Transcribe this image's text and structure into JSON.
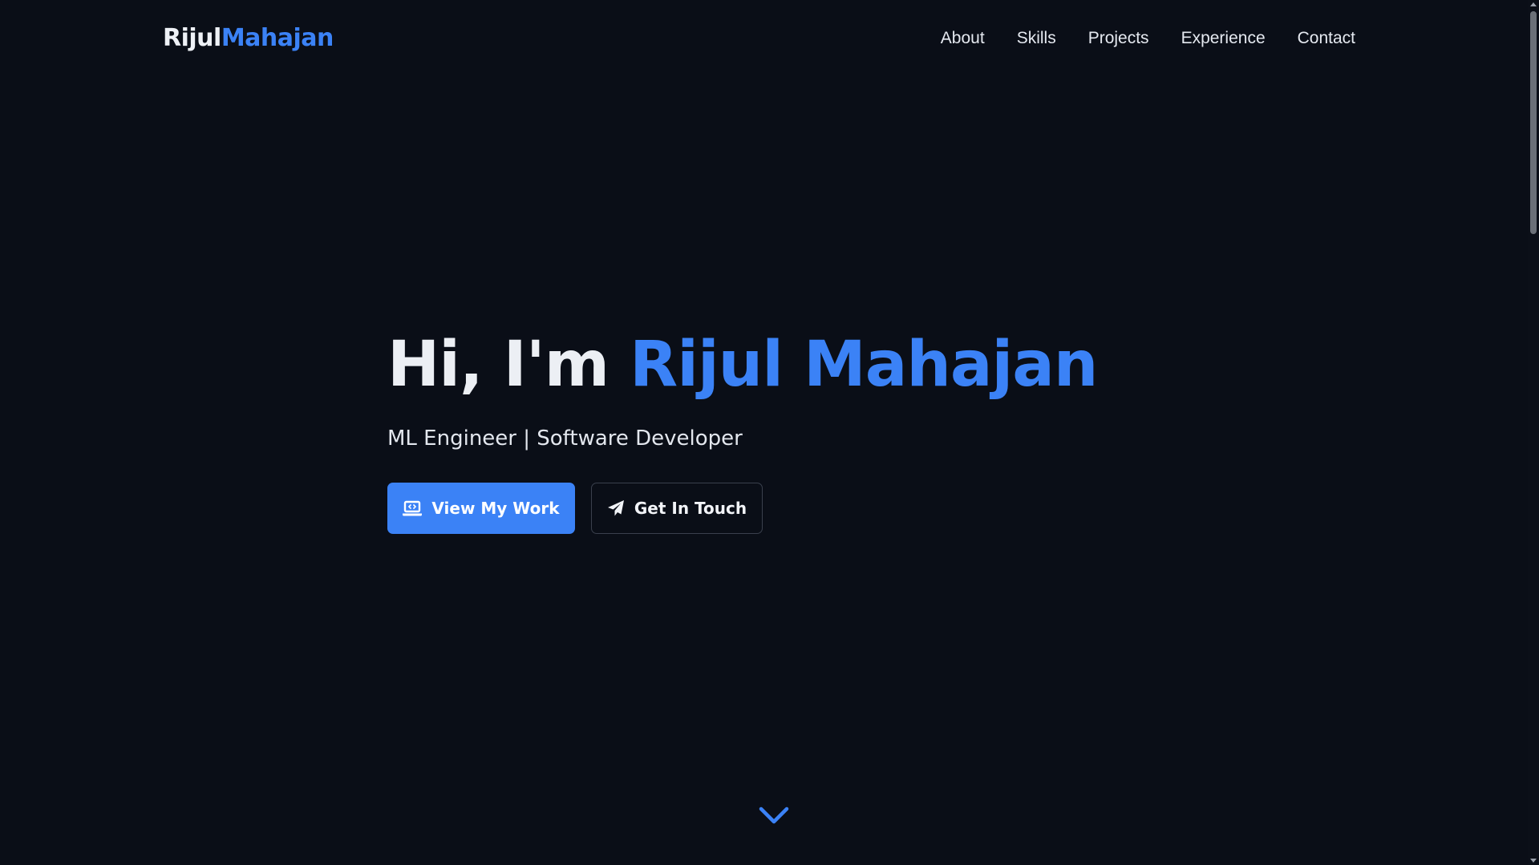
{
  "nav": {
    "logo_first": "Rijul",
    "logo_last": "Mahajan",
    "links": [
      "About",
      "Skills",
      "Projects",
      "Experience",
      "Contact"
    ]
  },
  "hero": {
    "greeting": "Hi, I'm",
    "name": "Rijul Mahajan",
    "subtitle": "ML Engineer | Software Developer",
    "primary_button": "View My Work",
    "primary_icon": "laptop-code-icon",
    "secondary_button": "Get In Touch",
    "secondary_icon": "paper-plane-icon"
  },
  "scroll_indicator": "chevron-down-icon",
  "colors": {
    "background": "#0a0e17",
    "accent": "#3b82f6",
    "text": "#eceff4",
    "button_border": "#3a404d"
  }
}
